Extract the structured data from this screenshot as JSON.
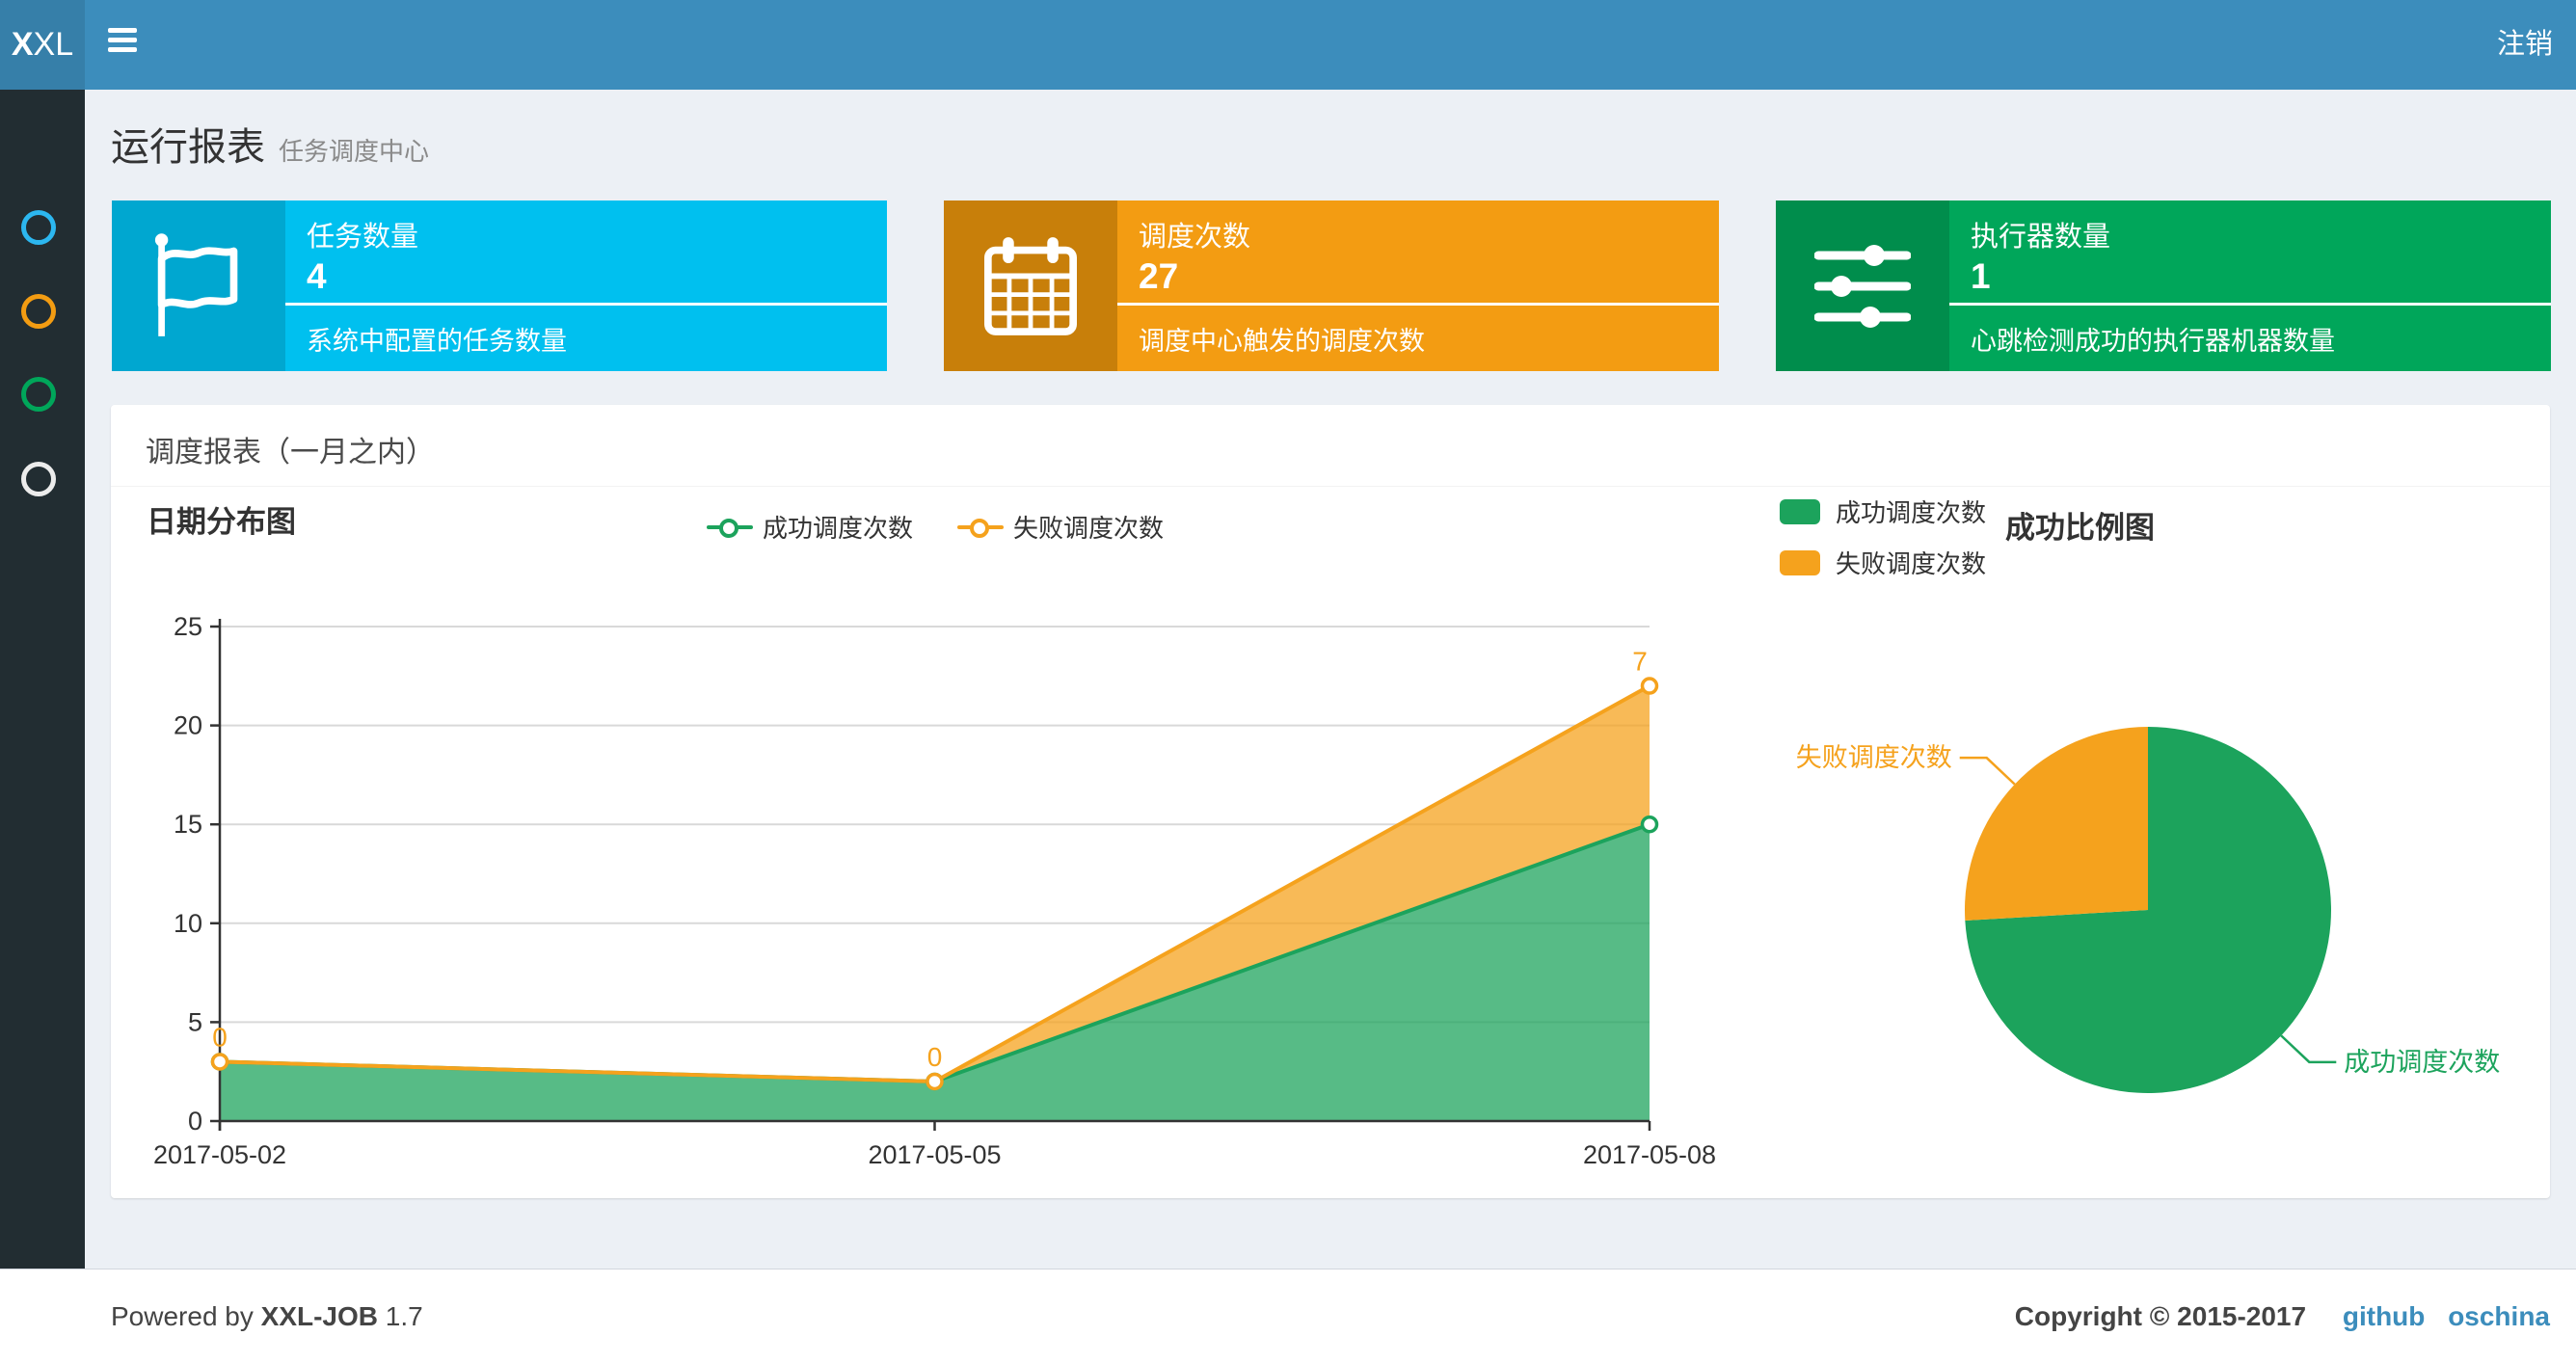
{
  "navbar": {
    "logo_bold": "X",
    "logo_rest": "XL",
    "logout": "注销"
  },
  "sidebar": {
    "items": [
      {
        "name": "run-report",
        "color": "#2cb7f0"
      },
      {
        "name": "job-manage",
        "color": "#f39c12"
      },
      {
        "name": "job-log",
        "color": "#00a65a"
      },
      {
        "name": "executor-manage",
        "color": "#ececec"
      }
    ]
  },
  "header": {
    "title": "运行报表",
    "subtitle": "任务调度中心"
  },
  "info_boxes": [
    {
      "icon": "flag-icon",
      "bg": "#00c0ef",
      "icon_bg": "#00a7d0",
      "label": "任务数量",
      "value": "4",
      "desc": "系统中配置的任务数量"
    },
    {
      "icon": "calendar-icon",
      "bg": "#f39c12",
      "icon_bg": "#c87f0a",
      "label": "调度次数",
      "value": "27",
      "desc": "调度中心触发的调度次数"
    },
    {
      "icon": "sliders-icon",
      "bg": "#00a65a",
      "icon_bg": "#008d4c",
      "label": "执行器数量",
      "value": "1",
      "desc": "心跳检测成功的执行器机器数量"
    }
  ],
  "panel": {
    "title": "调度报表（一月之内）"
  },
  "chart_data": [
    {
      "type": "area",
      "title": "日期分布图",
      "x": [
        "2017-05-02",
        "2017-05-05",
        "2017-05-08"
      ],
      "series": [
        {
          "name": "成功调度次数",
          "values": [
            3,
            2,
            15
          ],
          "color": "#1ca35c"
        },
        {
          "name": "失败调度次数",
          "values": [
            0,
            0,
            7
          ],
          "color": "#f5a21d"
        }
      ],
      "stacked": true,
      "point_labels_series": "失败调度次数",
      "point_labels": [
        "0",
        "0",
        "7"
      ],
      "ylim": [
        0,
        25
      ],
      "yticks": [
        0,
        5,
        10,
        15,
        20,
        25
      ],
      "grid": true,
      "legend_position": "top-center"
    },
    {
      "type": "pie",
      "title": "成功比例图",
      "slices": [
        {
          "name": "成功调度次数",
          "value": 20,
          "color": "#1ca35c"
        },
        {
          "name": "失败调度次数",
          "value": 7,
          "color": "#f5a21d"
        }
      ],
      "legend_position": "top-left"
    }
  ],
  "footer": {
    "powered_by": "Powered by",
    "product": "XXL-JOB",
    "version": "1.7",
    "copyright": "Copyright © 2015-2017",
    "links": [
      {
        "label": "github"
      },
      {
        "label": "oschina"
      }
    ],
    "link_color": "#3c8dbc"
  }
}
